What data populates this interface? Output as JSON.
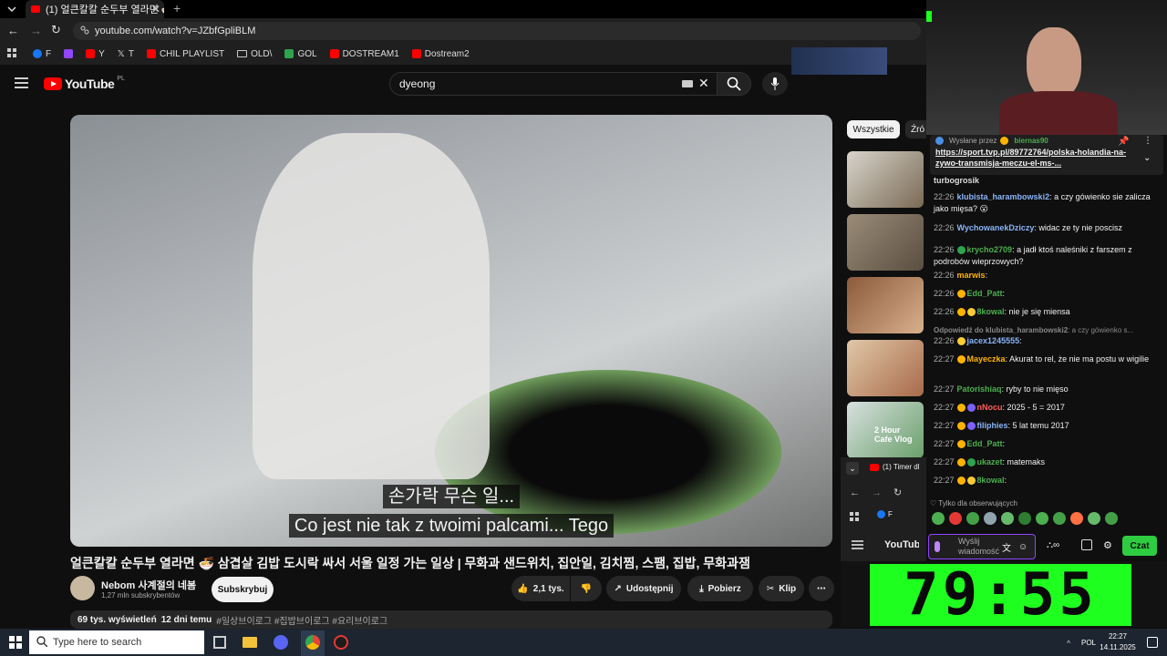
{
  "browser": {
    "tab_title": "(1) 얼큰칼칼 순두부 열라면 🍜",
    "url": "youtube.com/watch?v=JZbfGpliBLM",
    "bookmarks": [
      {
        "label": "F",
        "color": "#1877f2"
      },
      {
        "label": "",
        "color": "#9146ff"
      },
      {
        "label": "Y",
        "color": "#ff0000"
      },
      {
        "label": "T",
        "color": "#ffffff"
      },
      {
        "label": "CHIL PLAYLIST",
        "color": "#ff0000"
      },
      {
        "label": "OLD\\",
        "color": "#aaaaaa"
      },
      {
        "label": "GOL",
        "color": "#2ea44f"
      },
      {
        "label": "DOSTREAM1",
        "color": "#ff0000"
      },
      {
        "label": "Dostream2",
        "color": "#ff0000"
      }
    ]
  },
  "youtube": {
    "logo_text": "YouTube",
    "region": "PL",
    "search_value": "dyeong",
    "video": {
      "subtitle_ko": "손가락 무슨 일...",
      "subtitle_pl": "Co jest nie tak z twoimi palcami... Tego",
      "title": "얼큰칼칼 순두부 열라면 🍜 삼겹살 김밥 도시락 싸서 서울 일정 가는 일상 | 무화과 샌드위치, 집안일, 김치찜, 스팸, 집밥, 무화과잼",
      "channel_name": "Nebom 사계절의 네봄",
      "subscribers": "1,27 mln subskrybentów",
      "subscribe_label": "Subskrybuj",
      "likes": "2,1 tys.",
      "share_label": "Udostępnij",
      "download_label": "Pobierz",
      "clip_label": "Klip",
      "views": "69 tys. wyświetleń",
      "date": "12 dni temu",
      "hashtags": "#일상브이로그 #집밥브이로그 #요리브이로그"
    },
    "chips": {
      "all": "Wszystkie",
      "next": "Źró"
    },
    "thumb_overlay": "2 Hour Cafe Vlog"
  },
  "chat": {
    "pinned_by": "Wysłane przez",
    "pinned_user": "biernas90",
    "pinned_link": "https://sport.tvp.pl/89772764/polska-holandia-na-zywo-transmisja-meczu-el-ms-...",
    "messages": [
      {
        "time": "",
        "user": "turbogrosik",
        "color": "#dddddd",
        "text": "",
        "badges": []
      },
      {
        "time": "22:26",
        "user": "klubista_harambowski2",
        "color": "#8ab4f8",
        "text": ": a czy gówienko sie zalicza jako mięsa? 😮",
        "badges": []
      },
      {
        "time": "22:26",
        "user": "WychowanekDziczy",
        "color": "#8ab4f8",
        "text": ": widac ze ty nie poscisz",
        "badges": []
      },
      {
        "time": "22:26",
        "user": "krycho2709",
        "color": "#4caf50",
        "text": ": a jadł ktoś naleśniki z farszem z podrobów wieprzowych?",
        "badges": [
          "#2ea44f"
        ]
      },
      {
        "time": "22:26",
        "user": "marwis",
        "color": "#ffb300",
        "text": ":",
        "badges": []
      },
      {
        "time": "22:26",
        "user": "Edd_Patt",
        "color": "#4caf50",
        "text": ":",
        "badges": [
          "#ffb300"
        ]
      },
      {
        "time": "22:26",
        "user": "8kowal",
        "color": "#4caf50",
        "text": ": nie je się miensa",
        "badges": [
          "#ffb300",
          "#ffcc33"
        ]
      },
      {
        "time": "",
        "user": "Odpowiedź do klubista_harambowski2",
        "color": "#888888",
        "text": ": a czy gówienko s...",
        "badges": []
      },
      {
        "time": "22:26",
        "user": "jacex1245555",
        "color": "#8ab4f8",
        "text": ":",
        "badges": [
          "#ffcc33"
        ]
      },
      {
        "time": "22:27",
        "user": "Mayeczka",
        "color": "#ffb300",
        "text": ": Akurat to rel, że nie ma postu w wigilie",
        "badges": [
          "#ffb300"
        ]
      },
      {
        "time": "22:27",
        "user": "Patorishiaq",
        "color": "#4caf50",
        "text": ": ryby to nie mięso",
        "badges": []
      },
      {
        "time": "22:27",
        "user": "nNocu",
        "color": "#ff5c5c",
        "text": ": 2025 - 5 = 2017",
        "badges": [
          "#ffb300",
          "#7b61ff"
        ]
      },
      {
        "time": "22:27",
        "user": "filiphies",
        "color": "#8ab4f8",
        "text": ": 5 lat temu 2017",
        "badges": [
          "#ffb300",
          "#7b61ff"
        ]
      },
      {
        "time": "22:27",
        "user": "Edd_Patt",
        "color": "#4caf50",
        "text": ":",
        "badges": [
          "#ffb300"
        ]
      },
      {
        "time": "22:27",
        "user": "ukazet",
        "color": "#4caf50",
        "text": ": matemaks",
        "badges": [
          "#ffb300",
          "#2ea44f"
        ]
      },
      {
        "time": "22:27",
        "user": "8kowal",
        "color": "#4caf50",
        "text": ":",
        "badges": [
          "#ffb300",
          "#ffcc33"
        ]
      }
    ],
    "followers_only": "Tylko dla obserwujących",
    "input_placeholder": "Wyślij wiadomość",
    "send_label": "Czat"
  },
  "mini_browser": {
    "tab_title": "(1) Timer dl",
    "fb_label": "F"
  },
  "timer": {
    "display": "79:55"
  },
  "taskbar": {
    "search_placeholder": "Type here to search",
    "language": "POL",
    "time": "22:27",
    "date": "14.11.2025"
  },
  "colors": {
    "accent_red": "#ff0000",
    "timer_green": "#1fff1f",
    "send_green": "#2ecc40"
  }
}
